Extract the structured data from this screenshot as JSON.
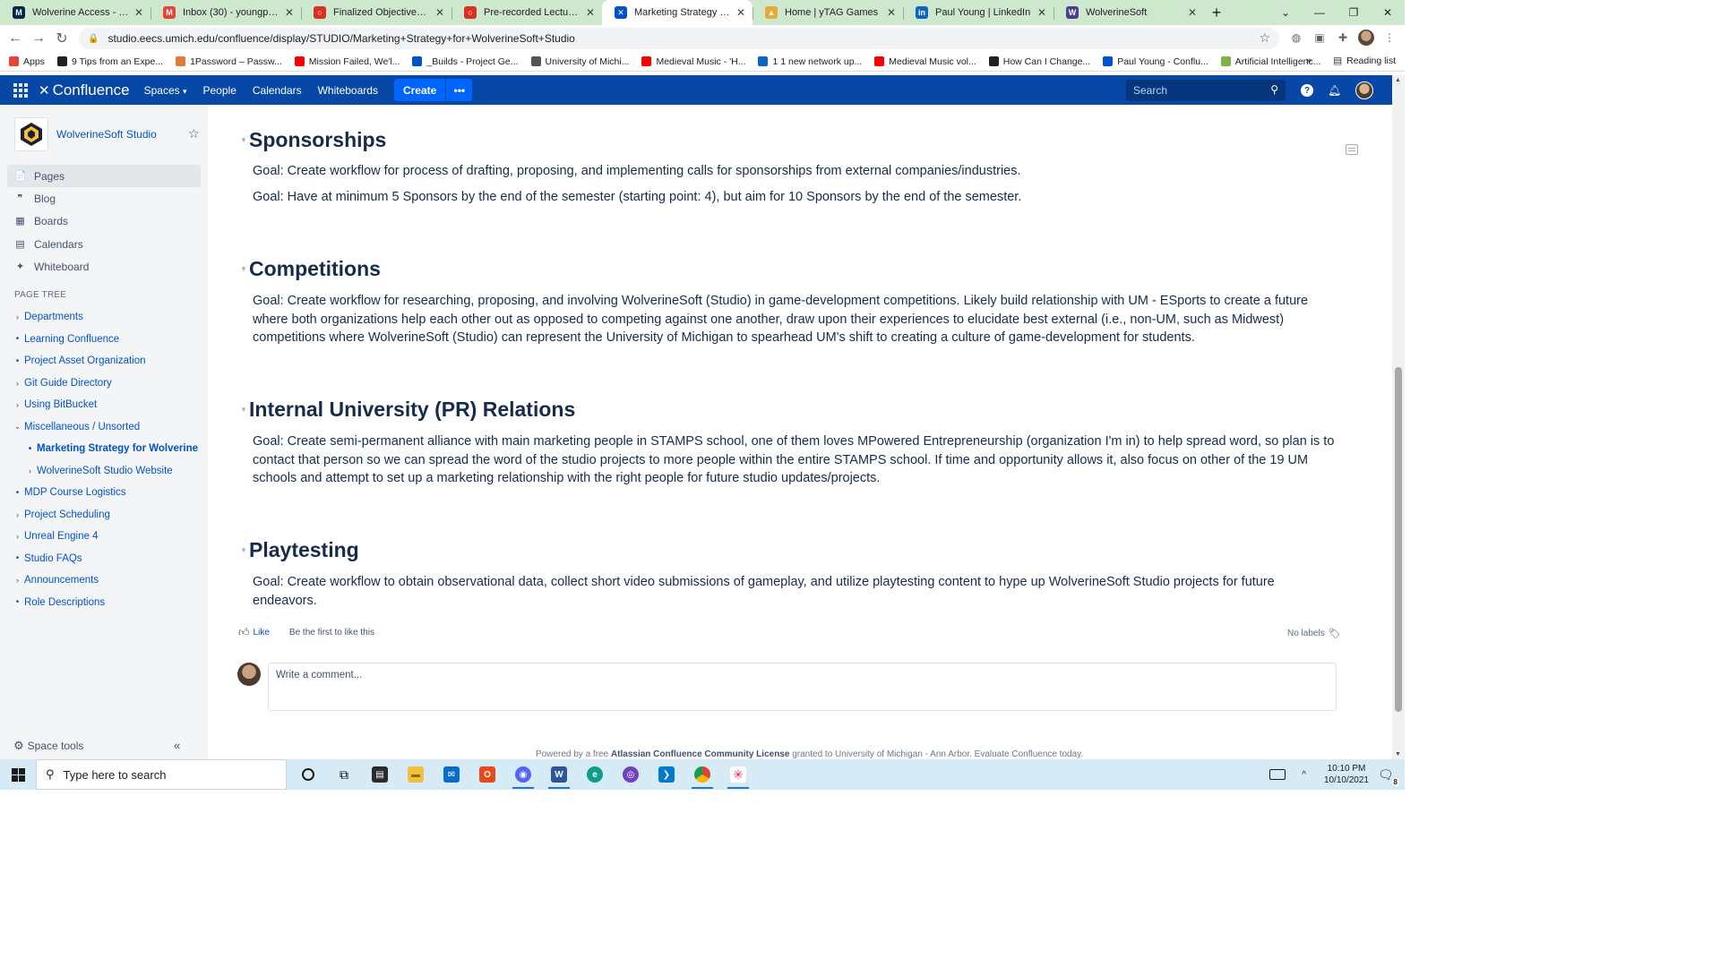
{
  "browser": {
    "tabs": [
      {
        "title": "Wolverine Access - Find &",
        "icon_color": "#00274c",
        "icon_letter": "M",
        "active": false
      },
      {
        "title": "Inbox (30) - youngpau@ur",
        "icon_color": "#ea4335",
        "icon_letter": "M",
        "active": false
      },
      {
        "title": "Finalized Objectives: Paul",
        "icon_color": "#d93025",
        "icon_letter": "○",
        "active": false
      },
      {
        "title": "Pre-recorded Lecture 2: El",
        "icon_color": "#d93025",
        "icon_letter": "○",
        "active": false
      },
      {
        "title": "Marketing Strategy for Wo",
        "icon_color": "#0052cc",
        "icon_letter": "✕",
        "active": true
      },
      {
        "title": "Home | yTAG Games",
        "icon_color": "#e8a93b",
        "icon_letter": "▲",
        "active": false
      },
      {
        "title": "Paul Young | LinkedIn",
        "icon_color": "#0a66c2",
        "icon_letter": "in",
        "active": false
      },
      {
        "title": "WolverineSoft",
        "icon_color": "#4a3f8f",
        "icon_letter": "W",
        "active": false
      }
    ],
    "new_tab": "+",
    "url": "studio.eecs.umich.edu/confluence/display/STUDIO/Marketing+Strategy+for+WolverineSoft+Studio",
    "bookmarks": [
      {
        "label": "Apps",
        "color": "#ea4335"
      },
      {
        "label": "9 Tips from an Expe...",
        "color": "#202124"
      },
      {
        "label": "1Password – Passw...",
        "color": "#e07b39"
      },
      {
        "label": "Mission Failed, We'l...",
        "color": "#ff0000"
      },
      {
        "label": "_Builds - Project Ge...",
        "color": "#0052cc"
      },
      {
        "label": "University of Michi...",
        "color": "#555555"
      },
      {
        "label": "Medieval Music - 'H...",
        "color": "#ff0000"
      },
      {
        "label": "1 1 new network up...",
        "color": "#0a66c2"
      },
      {
        "label": "Medieval Music vol...",
        "color": "#ff0000"
      },
      {
        "label": "How Can I Change...",
        "color": "#202124"
      },
      {
        "label": "Paul Young - Conflu...",
        "color": "#0052cc"
      },
      {
        "label": "Artificial Intelligenc...",
        "color": "#7cb342"
      }
    ],
    "bookmarks_more": "»",
    "reading_list": "Reading list"
  },
  "confluence": {
    "logo": "Confluence",
    "nav": [
      "Spaces",
      "People",
      "Calendars",
      "Whiteboards"
    ],
    "create": "Create",
    "more": "•••",
    "search_placeholder": "Search"
  },
  "sidebar": {
    "space_name": "WolverineSoft Studio",
    "nav": [
      {
        "label": "Pages",
        "icon": "📄",
        "selected": true
      },
      {
        "label": "Blog",
        "icon": "❞",
        "selected": false
      },
      {
        "label": "Boards",
        "icon": "▦",
        "selected": false
      },
      {
        "label": "Calendars",
        "icon": "▤",
        "selected": false
      },
      {
        "label": "Whiteboard",
        "icon": "✦",
        "selected": false
      }
    ],
    "page_tree_heading": "PAGE TREE",
    "tree": [
      {
        "label": "Departments",
        "toggle": "›",
        "indent": 0
      },
      {
        "label": "Learning Confluence",
        "toggle": "•",
        "indent": 0
      },
      {
        "label": "Project Asset Organization",
        "toggle": "•",
        "indent": 0
      },
      {
        "label": "Git Guide Directory",
        "toggle": "›",
        "indent": 0
      },
      {
        "label": "Using BitBucket",
        "toggle": "›",
        "indent": 0
      },
      {
        "label": "Miscellaneous / Unsorted",
        "toggle": "⌄",
        "indent": 0
      },
      {
        "label": "Marketing Strategy for Wolverine...",
        "toggle": "•",
        "indent": 1,
        "current": true
      },
      {
        "label": "WolverineSoft Studio Website",
        "toggle": "›",
        "indent": 1
      },
      {
        "label": "MDP Course Logistics",
        "toggle": "•",
        "indent": 0
      },
      {
        "label": "Project Scheduling",
        "toggle": "›",
        "indent": 0
      },
      {
        "label": "Unreal Engine 4",
        "toggle": "›",
        "indent": 0
      },
      {
        "label": "Studio FAQs",
        "toggle": "•",
        "indent": 0
      },
      {
        "label": "Announcements",
        "toggle": "›",
        "indent": 0
      },
      {
        "label": "Role Descriptions",
        "toggle": "•",
        "indent": 0
      }
    ],
    "space_tools": "Space tools",
    "collapse": "«"
  },
  "content": {
    "sections": [
      {
        "heading": "Sponsorships",
        "paragraphs": [
          "Goal: Create workflow for process of drafting, proposing, and implementing calls for sponsorships from external companies/industries.",
          "Goal: Have at minimum 5 Sponsors by the end of the semester (starting point: 4), but aim for 10 Sponsors by the end of the semester."
        ]
      },
      {
        "heading": "Competitions",
        "paragraphs": [
          "Goal: Create workflow for researching, proposing, and involving WolverineSoft (Studio) in game-development competitions. Likely build relationship with UM - ESports to create a future where both organizations help each other out as opposed to competing against one another, draw upon their experiences to elucidate best external (i.e., non-UM, such as Midwest) competitions where WolverineSoft (Studio) can represent the University of Michigan to spearhead UM's shift to creating a culture of game-development for students."
        ]
      },
      {
        "heading": "Internal University (PR) Relations",
        "paragraphs": [
          "Goal: Create semi-permanent alliance with main marketing people in STAMPS school, one of them loves MPowered Entrepreneurship (organization I'm in) to help spread word, so plan is to contact that person so we can spread the word of the studio projects to more people within the entire STAMPS school. If time and opportunity allows it, also focus on other of the 19 UM schools and attempt to set up a marketing relationship with the right people for future studio updates/projects."
        ]
      },
      {
        "heading": "Playtesting",
        "paragraphs": [
          "Goal: Create workflow to obtain observational data, collect short video submissions of gameplay, and utilize playtesting content to hype up WolverineSoft Studio projects for future endeavors."
        ]
      }
    ],
    "like": "Like",
    "be_first": "Be the first to like this",
    "no_labels": "No labels",
    "comment_placeholder": "Write a comment...",
    "footer_pre": "Powered by a free ",
    "footer_bold": "Atlassian Confluence Community License",
    "footer_post": " granted to University of Michigan - Ann Arbor. Evaluate Confluence today."
  },
  "taskbar": {
    "search_placeholder": "Type here to search",
    "time": "10:10 PM",
    "date": "10/10/2021",
    "notifications": "8"
  }
}
